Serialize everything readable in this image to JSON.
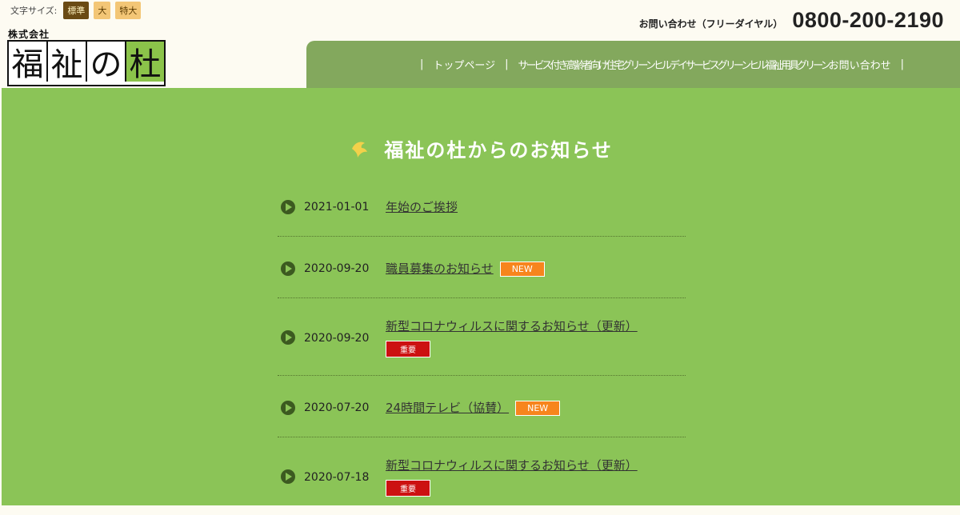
{
  "header": {
    "font_size_label": "文字サイズ:",
    "font_sizes": [
      "標準",
      "大",
      "特大"
    ],
    "company_small": "株式会社",
    "logo_chars": [
      "福",
      "祉",
      "の",
      "杜"
    ],
    "contact_label": "お問い合わせ（フリーダイヤル）",
    "phone": "0800-200-2190"
  },
  "nav": {
    "items": [
      "トップページ",
      "サービス付き高齢者向け住宅グリーンヒル",
      "デイサービス",
      "グリーンヒル",
      "福祉用具",
      "グリーン",
      "お問い合わせ"
    ]
  },
  "main": {
    "title": "福祉の杜からのお知らせ"
  },
  "news": [
    {
      "date": "2021-01-01",
      "title": "年始のご挨拶",
      "badge": ""
    },
    {
      "date": "2020-09-20",
      "title": "職員募集のお知らせ",
      "badge": "NEW"
    },
    {
      "date": "2020-09-20",
      "title": "新型コロナウィルスに関するお知らせ（更新）",
      "badge": "重要"
    },
    {
      "date": "2020-07-20",
      "title": "24時間テレビ（協賛）",
      "badge": "NEW"
    },
    {
      "date": "2020-07-18",
      "title": "新型コロナウィルスに関するお知らせ（更新）",
      "badge": "重要"
    }
  ],
  "colors": {
    "header_bg": "#fdfbf2",
    "nav_bg": "#83a85d",
    "main_bg": "#8bc457",
    "new_badge": "#f7851d",
    "important_badge": "#cc1111"
  }
}
